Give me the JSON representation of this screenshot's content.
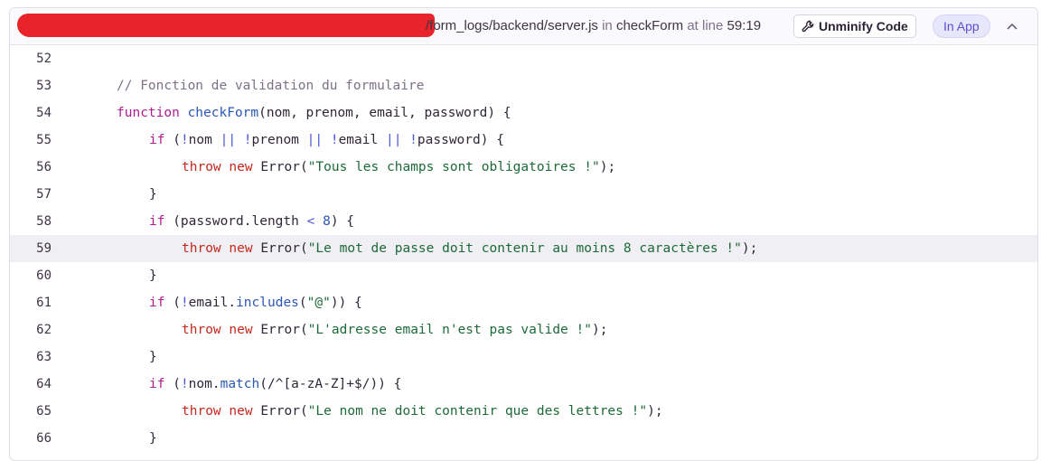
{
  "header": {
    "path": "/form_logs/backend/server.js",
    "in_word": "in",
    "function_name": "checkForm",
    "at_line_word": "at line",
    "position": "59:19",
    "unminify_label": "Unminify Code",
    "in_app_label": "In App"
  },
  "code": {
    "active_line": 59,
    "lines": [
      {
        "n": "52",
        "tokens": []
      },
      {
        "n": "53",
        "tokens": [
          {
            "c": "t-comment",
            "t": "// Fonction de validation du formulaire"
          }
        ]
      },
      {
        "n": "54",
        "tokens": [
          {
            "c": "t-ctl",
            "t": "function"
          },
          {
            "c": "",
            "t": " "
          },
          {
            "c": "t-fn",
            "t": "checkForm"
          },
          {
            "c": "",
            "t": "(nom, prenom, email, password) {"
          }
        ]
      },
      {
        "n": "55",
        "tokens": [
          {
            "c": "t-ctl",
            "t": "if"
          },
          {
            "c": "",
            "t": " ("
          },
          {
            "c": "t-op",
            "t": "!"
          },
          {
            "c": "",
            "t": "nom "
          },
          {
            "c": "t-op",
            "t": "||"
          },
          {
            "c": "",
            "t": " "
          },
          {
            "c": "t-op",
            "t": "!"
          },
          {
            "c": "",
            "t": "prenom "
          },
          {
            "c": "t-op",
            "t": "||"
          },
          {
            "c": "",
            "t": " "
          },
          {
            "c": "t-op",
            "t": "!"
          },
          {
            "c": "",
            "t": "email "
          },
          {
            "c": "t-op",
            "t": "||"
          },
          {
            "c": "",
            "t": " "
          },
          {
            "c": "t-op",
            "t": "!"
          },
          {
            "c": "",
            "t": "password) {"
          }
        ]
      },
      {
        "n": "56",
        "tokens": [
          {
            "c": "t-kw",
            "t": "throw"
          },
          {
            "c": "",
            "t": " "
          },
          {
            "c": "t-kw",
            "t": "new"
          },
          {
            "c": "",
            "t": " Error("
          },
          {
            "c": "t-str",
            "t": "\"Tous les champs sont obligatoires !\""
          },
          {
            "c": "",
            "t": ");"
          }
        ]
      },
      {
        "n": "57",
        "tokens": [
          {
            "c": "",
            "t": "}"
          }
        ]
      },
      {
        "n": "58",
        "tokens": [
          {
            "c": "t-ctl",
            "t": "if"
          },
          {
            "c": "",
            "t": " (password.length "
          },
          {
            "c": "t-op",
            "t": "<"
          },
          {
            "c": "",
            "t": " "
          },
          {
            "c": "t-fn",
            "t": "8"
          },
          {
            "c": "",
            "t": ") {"
          }
        ]
      },
      {
        "n": "59",
        "tokens": [
          {
            "c": "t-kw",
            "t": "throw"
          },
          {
            "c": "",
            "t": " "
          },
          {
            "c": "t-kw",
            "t": "new"
          },
          {
            "c": "",
            "t": " Error("
          },
          {
            "c": "t-str",
            "t": "\"Le mot de passe doit contenir au moins 8 caractères !\""
          },
          {
            "c": "",
            "t": ");"
          }
        ]
      },
      {
        "n": "60",
        "tokens": [
          {
            "c": "",
            "t": "}"
          }
        ]
      },
      {
        "n": "61",
        "tokens": [
          {
            "c": "t-ctl",
            "t": "if"
          },
          {
            "c": "",
            "t": " ("
          },
          {
            "c": "t-op",
            "t": "!"
          },
          {
            "c": "",
            "t": "email."
          },
          {
            "c": "t-fn",
            "t": "includes"
          },
          {
            "c": "",
            "t": "("
          },
          {
            "c": "t-str",
            "t": "\"@\""
          },
          {
            "c": "",
            "t": ")) {"
          }
        ]
      },
      {
        "n": "62",
        "tokens": [
          {
            "c": "t-kw",
            "t": "throw"
          },
          {
            "c": "",
            "t": " "
          },
          {
            "c": "t-kw",
            "t": "new"
          },
          {
            "c": "",
            "t": " Error("
          },
          {
            "c": "t-str",
            "t": "\"L'adresse email n'est pas valide !\""
          },
          {
            "c": "",
            "t": ");"
          }
        ]
      },
      {
        "n": "63",
        "tokens": [
          {
            "c": "",
            "t": "}"
          }
        ]
      },
      {
        "n": "64",
        "tokens": [
          {
            "c": "t-ctl",
            "t": "if"
          },
          {
            "c": "",
            "t": " ("
          },
          {
            "c": "t-op",
            "t": "!"
          },
          {
            "c": "",
            "t": "nom."
          },
          {
            "c": "t-fn",
            "t": "match"
          },
          {
            "c": "",
            "t": "(/^[a-zA-Z]+$/)) {"
          }
        ]
      },
      {
        "n": "65",
        "tokens": [
          {
            "c": "t-kw",
            "t": "throw"
          },
          {
            "c": "",
            "t": " "
          },
          {
            "c": "t-kw",
            "t": "new"
          },
          {
            "c": "",
            "t": " Error("
          },
          {
            "c": "t-str",
            "t": "\"Le nom ne doit contenir que des lettres !\""
          },
          {
            "c": "",
            "t": ");"
          }
        ]
      },
      {
        "n": "66",
        "tokens": [
          {
            "c": "",
            "t": "}"
          }
        ]
      }
    ]
  }
}
